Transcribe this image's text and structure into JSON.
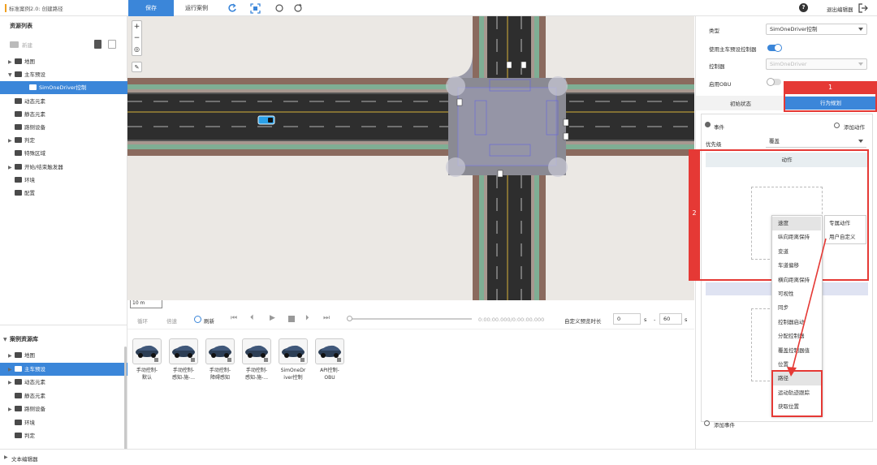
{
  "topbar": {
    "title": "标准案例2.0: 创建路径",
    "save_label": "保存",
    "run_label": "运行案例",
    "exit_label": "退出编辑器"
  },
  "left": {
    "resource_list_title": "资源列表",
    "new_label": "新建",
    "tree": [
      {
        "label": "地图",
        "arrow": "▶"
      },
      {
        "label": "主车预设",
        "arrow": "▼"
      },
      {
        "label": "SimOneDriver控制",
        "arrow": ""
      },
      {
        "label": "动态元素",
        "arrow": ""
      },
      {
        "label": "静态元素",
        "arrow": ""
      },
      {
        "label": "路侧设备",
        "arrow": ""
      },
      {
        "label": "判定",
        "arrow": "▶"
      },
      {
        "label": "特殊区域",
        "arrow": ""
      },
      {
        "label": "开始/结束触发器",
        "arrow": "▶"
      },
      {
        "label": "环境",
        "arrow": ""
      },
      {
        "label": "配置",
        "arrow": ""
      }
    ],
    "case_library_title": "案例资源库",
    "lib_tree": [
      {
        "label": "地图",
        "arrow": "▶"
      },
      {
        "label": "主车预设",
        "arrow": "▶"
      },
      {
        "label": "动态元素",
        "arrow": "▶"
      },
      {
        "label": "静态元素",
        "arrow": ""
      },
      {
        "label": "路侧设备",
        "arrow": "▶"
      },
      {
        "label": "环境",
        "arrow": ""
      },
      {
        "label": "判定",
        "arrow": ""
      }
    ]
  },
  "canvas": {
    "scale_label": "10 m"
  },
  "playbar": {
    "loop_label": "循环",
    "speed_label": "倍速",
    "refresh_label": "刷新",
    "time_readout": "0:00:00.000/0:00:00.000",
    "preview_label": "自定义预览时长",
    "start_value": "0",
    "start_unit": "s",
    "dash": "-",
    "end_value": "60",
    "end_unit": "s"
  },
  "library_items": [
    {
      "line1": "手动控制-",
      "line2": "默认"
    },
    {
      "line1": "手动控制-",
      "line2": "感知-施-..."
    },
    {
      "line1": "手动控制-",
      "line2": "障碍感知"
    },
    {
      "line1": "手动控制-",
      "line2": "感知-施-..."
    },
    {
      "line1": "SimOneDr",
      "line2": "iver控制"
    },
    {
      "line1": "API控制-",
      "line2": "OBU"
    }
  ],
  "right": {
    "type_label": "类型",
    "type_value": "SimOneDriver控制",
    "use_preset_label": "使用主车预设控制器",
    "controller_label": "控制器",
    "controller_value": "SimOneDriver",
    "obu_label": "启用OBU",
    "tab_initial": "初始状态",
    "tab_behavior": "行为规划",
    "event_label": "事件",
    "add_action_label": "添加动作",
    "priority_label": "优先级",
    "priority_value": "覆盖",
    "action_header": "动作",
    "add_event_label": "添加事件"
  },
  "annotations": {
    "badge1": "1",
    "badge2": "2"
  },
  "menu": {
    "items": [
      "速度",
      "纵向距离保持",
      "变道",
      "车道偏移",
      "横向距离保持",
      "可视性",
      "同步",
      "控制器启动",
      "分配控制器",
      "覆盖控制器值",
      "位置",
      "路径",
      "运动轨迹跟踪",
      "获取位置"
    ],
    "submenu": [
      "专属动作",
      "用户自定义"
    ]
  },
  "footer": {
    "text_editor_label": "文本编辑器"
  },
  "colors": {
    "accent": "#3b86d9",
    "annotation_red": "#e53935",
    "road": "#2e2e2e",
    "sidewalk": "#8a6a5e",
    "grass": "#7fae94"
  }
}
